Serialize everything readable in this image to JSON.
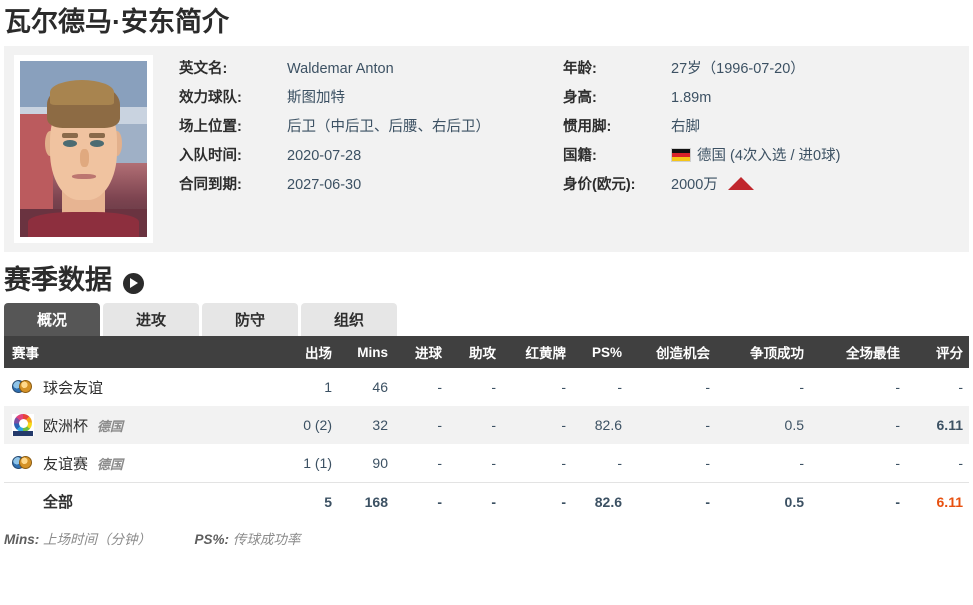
{
  "page_title": "瓦尔德马·安东简介",
  "profile": {
    "photo_alt": "player-photo",
    "left": [
      {
        "label": "英文名:",
        "value": "Waldemar Anton"
      },
      {
        "label": "效力球队:",
        "value": "斯图加特"
      },
      {
        "label": "场上位置:",
        "value": "后卫（中后卫、后腰、右后卫）"
      },
      {
        "label": "入队时间:",
        "value": "2020-07-28"
      },
      {
        "label": "合同到期:",
        "value": "2027-06-30"
      }
    ],
    "right": [
      {
        "label": "年龄:",
        "value": "27岁（1996-07-20）"
      },
      {
        "label": "身高:",
        "value": "1.89m"
      },
      {
        "label": "惯用脚:",
        "value": "右脚"
      },
      {
        "label": "国籍:",
        "value": "德国 (4次入选 / 进0球)",
        "flag": "germany-flag"
      },
      {
        "label": "身价(欧元):",
        "value": "2000万",
        "trend": "up"
      }
    ]
  },
  "season_section": {
    "title": "赛季数据",
    "arrow_icon": "arrow-right-circle-icon"
  },
  "tabs": [
    {
      "label": "概况",
      "active": true
    },
    {
      "label": "进攻",
      "active": false
    },
    {
      "label": "防守",
      "active": false
    },
    {
      "label": "组织",
      "active": false
    }
  ],
  "table": {
    "headers": [
      "赛事",
      "出场",
      "Mins",
      "进球",
      "助攻",
      "红黄牌",
      "PS%",
      "创造机会",
      "争顶成功",
      "全场最佳",
      "评分"
    ],
    "rows": [
      {
        "icon": "globes-icon",
        "competition": "球会友谊",
        "country": "",
        "apps": "1",
        "mins": "46",
        "goals": "-",
        "assists": "-",
        "cards": "-",
        "ps": "-",
        "chances": "-",
        "aerial": "-",
        "motm": "-",
        "rating": "-"
      },
      {
        "icon": "euro-cup-icon",
        "competition": "欧洲杯",
        "country": "德国",
        "apps": "0 (2)",
        "mins": "32",
        "goals": "-",
        "assists": "-",
        "cards": "-",
        "ps": "82.6",
        "chances": "-",
        "aerial": "0.5",
        "motm": "-",
        "rating": "6.11"
      },
      {
        "icon": "globes-icon",
        "competition": "友谊赛",
        "country": "德国",
        "apps": "1 (1)",
        "mins": "90",
        "goals": "-",
        "assists": "-",
        "cards": "-",
        "ps": "-",
        "chances": "-",
        "aerial": "-",
        "motm": "-",
        "rating": "-"
      }
    ],
    "total": {
      "competition": "全部",
      "apps": "5",
      "mins": "168",
      "goals": "-",
      "assists": "-",
      "cards": "-",
      "ps": "82.6",
      "chances": "-",
      "aerial": "0.5",
      "motm": "-",
      "rating": "6.11"
    }
  },
  "footnote": {
    "mins_key": "Mins:",
    "mins_desc": "上场时间（分钟）",
    "ps_key": "PS%:",
    "ps_desc": "传球成功率"
  },
  "colors": {
    "header_bg": "#404040",
    "active_tab": "#565656",
    "rating": "#e8500f",
    "value_up": "#c0272d",
    "panel_bg": "#f2f2f2"
  }
}
